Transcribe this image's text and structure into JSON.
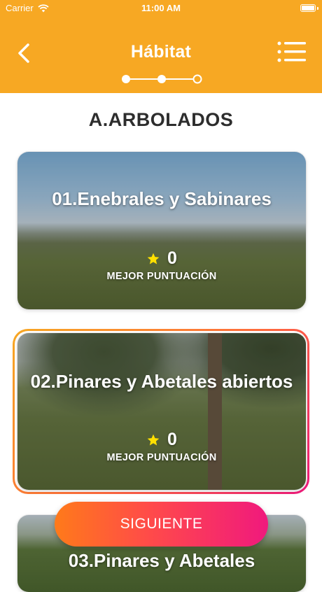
{
  "status_bar": {
    "carrier": "Carrier",
    "time": "11:00 AM"
  },
  "header": {
    "title": "Hábitat",
    "back_icon": "chevron-left-icon",
    "menu_icon": "list-menu-icon"
  },
  "stepper": {
    "steps_total": 3,
    "current_step": 3
  },
  "section": {
    "title": "A.ARBOLADOS"
  },
  "cards": [
    {
      "name": "01.Enebrales y Sabinares",
      "score": "0",
      "score_label": "MEJOR PUNTUACIÓN",
      "selected": false
    },
    {
      "name": "02.Pinares y Abetales abiertos",
      "score": "0",
      "score_label": "MEJOR PUNTUACIÓN",
      "selected": true
    },
    {
      "name": "03.Pinares y Abetales",
      "selected": false
    }
  ],
  "next_button": {
    "label": "SIGUIENTE"
  },
  "colors": {
    "brand": "#F7A823",
    "gradient_start": "#FF7A1A",
    "gradient_end": "#F0197D",
    "star": "#FFE000"
  }
}
